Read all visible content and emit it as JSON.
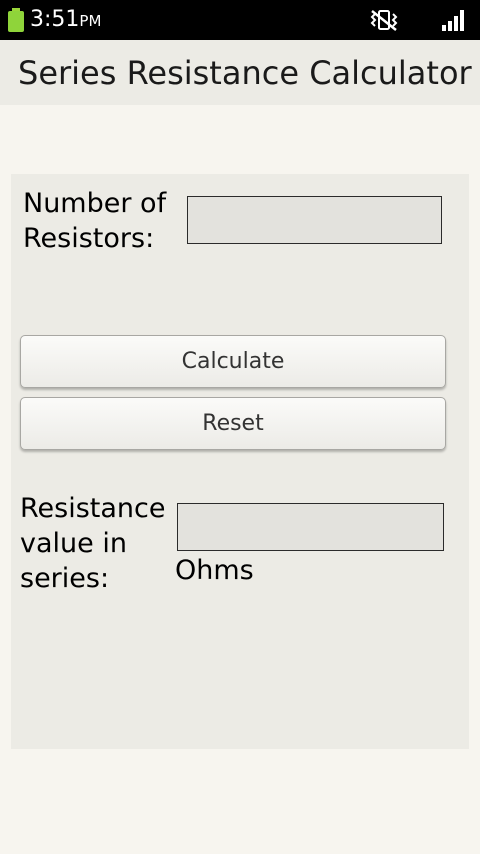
{
  "status_bar": {
    "time": "3:51",
    "ampm": "PM",
    "icons": [
      "battery-icon",
      "vibrate-icon",
      "signal-icon"
    ]
  },
  "app": {
    "title": "Series Resistance Calculator"
  },
  "form": {
    "resistors_label": "Number of Resistors:",
    "resistors_value": "",
    "calculate_label": "Calculate",
    "reset_label": "Reset",
    "result_label": "Resistance value in series:",
    "result_value": "",
    "unit_label": "Ohms"
  },
  "colors": {
    "status_bar": "#000000",
    "battery": "#8fd43a",
    "title_bar": "#ecebe5",
    "background": "#f7f5ef",
    "panel": "#ecebe5",
    "input_fill": "#e3e2dd"
  }
}
